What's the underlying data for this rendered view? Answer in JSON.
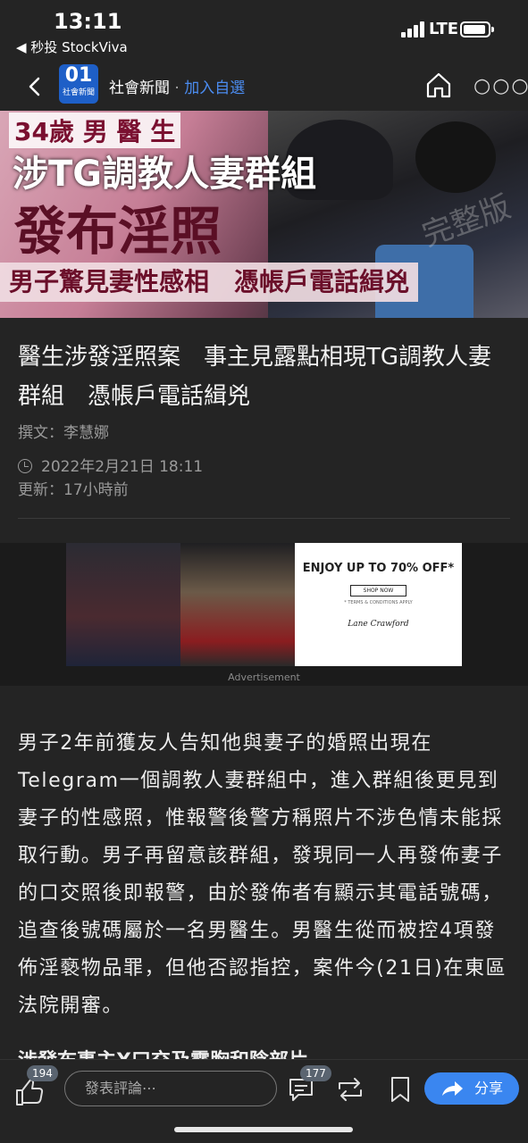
{
  "status_bar": {
    "time": "13:11",
    "back_app": "◀ 秒投 StockViva",
    "network": "LTE"
  },
  "nav": {
    "logo_big": "01",
    "logo_small": "社會新聞",
    "channel": "社會新聞",
    "separator": "·",
    "follow": "加入自選",
    "more": "○○○"
  },
  "hero": {
    "line1": "34歲 男 醫 生",
    "line2": "涉TG調教人妻群組",
    "line3": "發布淫照",
    "sub_banner": "男子驚見妻性感相　憑帳戶電話緝兇",
    "stamp": "完整版"
  },
  "article": {
    "headline": "醫生涉發淫照案　事主見露點相現TG調教人妻群組　憑帳戶電話緝兇",
    "author": "撰文：李慧娜",
    "published": "2022年2月21日 18:11",
    "updated": "更新：17小時前",
    "body": "男子2年前獲友人告知他與妻子的婚照出現在Telegram一個調教人妻群組中，進入群組後更見到妻子的性感照，惟報警後警方稱照片不涉色情未能採取行動。男子再留意該群組，發現同一人再發佈妻子的口交照後即報警，由於發佈者有顯示其電話號碼，追查後號碼屬於一名男醫生。男醫生從而被控4項發佈淫褻物品罪，但他否認指控，案件今(21日)在東區法院開審。",
    "next_heading": "涉發布事主X口交及露胸和陰部片"
  },
  "ad": {
    "headline": "ENJOY UP TO 70% OFF*",
    "shop_now": "SHOP NOW",
    "terms": "* TERMS & CONDITIONS APPLY",
    "brand": "Lane Crawford",
    "label": "Advertisement"
  },
  "bottom_bar": {
    "like_count": "194",
    "comment_placeholder": "發表評論⋯",
    "comment_count": "177",
    "share_label": "分享"
  },
  "colors": {
    "background": "#242424",
    "accent": "#3a86f0",
    "follow": "#4b8cf0",
    "logo_bg": "#1e5fc7"
  }
}
